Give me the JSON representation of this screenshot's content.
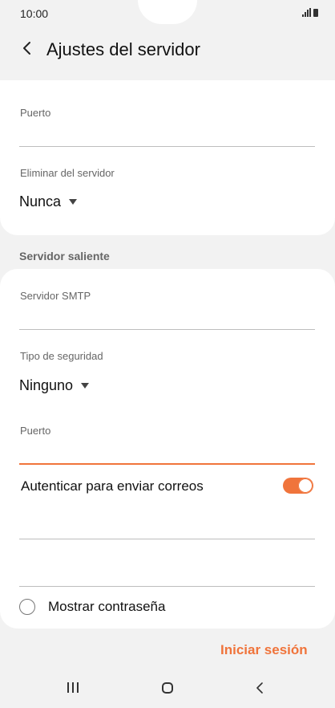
{
  "status_bar": {
    "time": "10:00"
  },
  "app_bar": {
    "title": "Ajustes del servidor"
  },
  "incoming": {
    "port_label": "Puerto",
    "port_value": "",
    "delete_label": "Eliminar del servidor",
    "delete_value": "Nunca"
  },
  "outgoing": {
    "section_label": "Servidor saliente",
    "smtp_label": "Servidor SMTP",
    "smtp_value": "",
    "security_label": "Tipo de seguridad",
    "security_value": "Ninguno",
    "port_label": "Puerto",
    "port_value": "",
    "auth_label": "Autenticar para enviar correos",
    "auth_enabled": true,
    "username_value": "",
    "password_value": "",
    "show_password_label": "Mostrar contraseña",
    "show_password_checked": false
  },
  "actions": {
    "sign_in_label": "Iniciar sesión"
  },
  "colors": {
    "accent": "#f0743b",
    "background": "#f2f2f2",
    "card": "#ffffff"
  }
}
